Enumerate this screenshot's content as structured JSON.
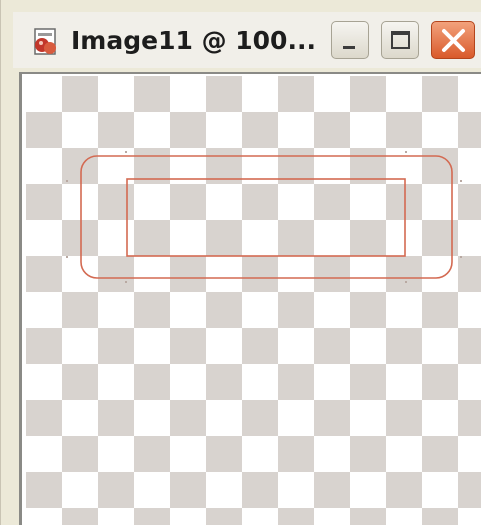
{
  "window": {
    "title": "Image11 @ 100...",
    "icon": "image-document-icon",
    "controls": [
      "minimize-icon",
      "maximize-icon",
      "close-icon"
    ]
  },
  "colors": {
    "shape_stroke": "#d36a52",
    "checker_dark": "#d8d3cf",
    "checker_light": "#ffffff",
    "close_button": "#d95a2b"
  },
  "canvas": {
    "background": "transparency-checkerboard",
    "shapes": [
      "outer-rounded-rectangle",
      "inner-rectangle"
    ]
  }
}
